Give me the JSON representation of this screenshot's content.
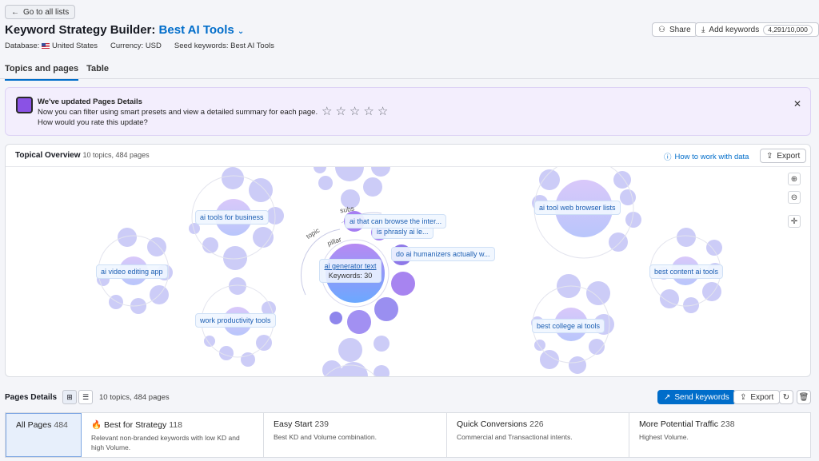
{
  "header": {
    "back_label": "Go to all lists",
    "title_prefix": "Keyword Strategy Builder:",
    "title_list": "Best AI Tools",
    "database_label": "Database:",
    "database_value": "United States",
    "currency": "Currency: USD",
    "seeds": "Seed keywords: Best AI Tools",
    "share_label": "Share",
    "add_keywords_label": "Add keywords",
    "keyword_quota": "4,291/10,000"
  },
  "tabs": [
    {
      "label": "Topics and pages",
      "active": true
    },
    {
      "label": "Table",
      "active": false
    }
  ],
  "banner": {
    "title": "We've updated Pages Details",
    "line1": "Now you can filter using smart presets and view a detailed summary for each page.",
    "line2": "How would you rate this update?",
    "stars": [
      "☆",
      "☆",
      "☆",
      "☆",
      "☆"
    ]
  },
  "overview": {
    "title": "Topical Overview",
    "meta": "10 topics, 484 pages",
    "how_link": "How to work with data",
    "export_label": "Export",
    "arc_labels": {
      "topic": "topic",
      "subs": "subs",
      "pillar": "pillar"
    },
    "center": {
      "topic": "ai generator text",
      "keywords": "Keywords: 30"
    },
    "topics": [
      "ai tools for business",
      "ai video editing app",
      "work productivity tools",
      "ai tool web browser lists",
      "best content ai tools",
      "best college ai tools"
    ],
    "subtopics": [
      "ai that can browse the inter...",
      "is phrasly ai le...",
      "do ai humanizers actually w..."
    ]
  },
  "pages_details": {
    "title": "Pages Details",
    "meta": "10 topics, 484 pages",
    "send_label": "Send keywords",
    "export_label": "Export",
    "cards": [
      {
        "title": "All Pages",
        "count": "484",
        "desc": "",
        "active": true
      },
      {
        "title": "Best for Strategy",
        "count": "118",
        "desc": "Relevant non-branded keywords with low KD and high Volume.",
        "active": false
      },
      {
        "title": "Easy Start",
        "count": "239",
        "desc": "Best KD and Volume combination.",
        "active": false
      },
      {
        "title": "Quick Conversions",
        "count": "226",
        "desc": "Commercial and Transactional intents.",
        "active": false
      },
      {
        "title": "More Potential Traffic",
        "count": "238",
        "desc": "Highest Volume.",
        "active": false
      }
    ]
  },
  "colors": {
    "accent": "#006dca",
    "bubble": "#c9cbf7",
    "purple": "#a77ff0"
  }
}
